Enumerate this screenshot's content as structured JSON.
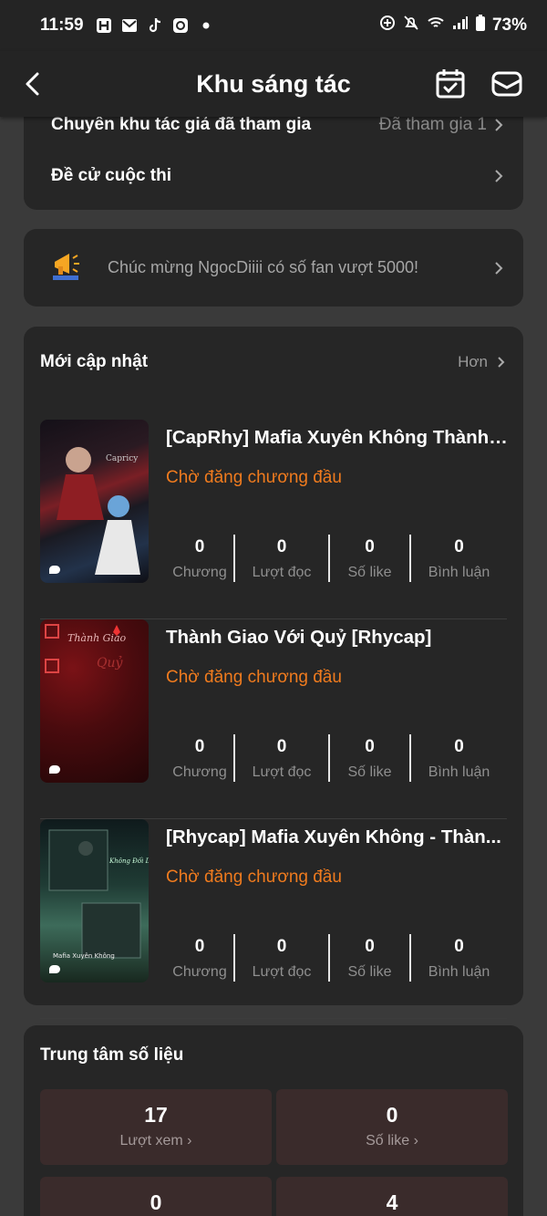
{
  "status_bar": {
    "time": "11:59",
    "battery": "73%"
  },
  "nav": {
    "title": "Khu sáng tác"
  },
  "links": {
    "author_zone_label": "Chuyên khu tác giả đã tham gia",
    "author_zone_value": "Đã tham gia 1",
    "contest_label": "Đề cử cuộc thi"
  },
  "banner": {
    "text": "Chúc mừng NgocDiiii có số fan vượt 5000!"
  },
  "recent": {
    "title": "Mới cập nhật",
    "more": "Hơn",
    "stat_labels": [
      "Chương",
      "Lượt đọc",
      "Số like",
      "Bình luận"
    ],
    "books": [
      {
        "title": "[CapRhy] Mafia Xuyên Không Thành ...",
        "status": "Chờ đăng chương đầu",
        "stats": [
          "0",
          "0",
          "0",
          "0"
        ]
      },
      {
        "title": "Thành Giao Với Quỷ [Rhycap]",
        "status": "Chờ đăng chương đầu",
        "stats": [
          "0",
          "0",
          "0",
          "0"
        ]
      },
      {
        "title": "[Rhycap] Mafia Xuyên Không - Thàn...",
        "status": "Chờ đăng chương đầu",
        "stats": [
          "0",
          "0",
          "0",
          "0"
        ]
      }
    ]
  },
  "data_center": {
    "title": "Trung tâm số liệu",
    "tiles": [
      {
        "value": "17",
        "label": "Lượt xem"
      },
      {
        "value": "0",
        "label": "Số like"
      },
      {
        "value": "0",
        "label": ""
      },
      {
        "value": "4",
        "label": ""
      }
    ]
  },
  "colors": {
    "accent": "#f07b1e",
    "card": "#262626",
    "page": "#3a3a3a",
    "tile": "#3a2b2b"
  }
}
